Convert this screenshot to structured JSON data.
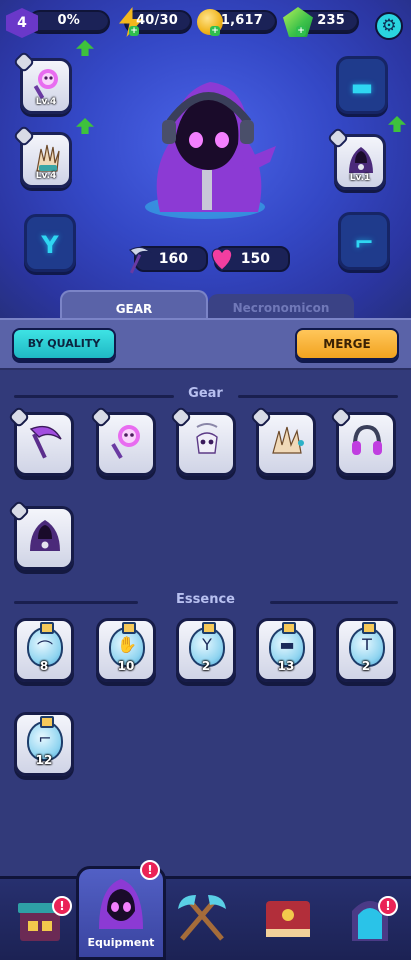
{
  "hud": {
    "level": "4",
    "xp_percent": "0%",
    "energy": "40/30",
    "coins": "1,617",
    "gems": "235",
    "settings_icon": "gear-icon"
  },
  "equipped": {
    "weapon": {
      "level": "Lv.4",
      "icon": "scythe-staff-icon",
      "upgrade_available": true
    },
    "gloves": {
      "level": "Lv.4",
      "icon": "claw-glove-icon",
      "upgrade_available": true
    },
    "necklace": {
      "icon": "necklace-icon",
      "empty": true
    },
    "hat": {
      "icon": "top-hat-icon",
      "empty": true
    },
    "cloak": {
      "level": "Lv.1",
      "icon": "hooded-cloak-icon",
      "upgrade_available": true
    },
    "boots": {
      "icon": "boot-icon",
      "empty": true
    }
  },
  "stats": {
    "attack": "160",
    "health": "150"
  },
  "tabs": {
    "gear": "GEAR",
    "necronomicon": "Necronomicon"
  },
  "toolbar": {
    "sort_label": "BY QUALITY",
    "merge_label": "MERGE"
  },
  "inventory": {
    "gear_heading": "Gear",
    "essence_heading": "Essence",
    "gear_items": [
      {
        "icon": "scythe-icon"
      },
      {
        "icon": "skull-staff-icon"
      },
      {
        "icon": "skull-amulet-icon"
      },
      {
        "icon": "bone-claw-icon"
      },
      {
        "icon": "headphones-icon"
      },
      {
        "icon": "hooded-cloak-icon"
      }
    ],
    "essence_items": [
      {
        "icon": "scythe-essence-icon",
        "count": "8"
      },
      {
        "icon": "glove-essence-icon",
        "count": "10"
      },
      {
        "icon": "necklace-essence-icon",
        "count": "2"
      },
      {
        "icon": "hat-essence-icon",
        "count": "13"
      },
      {
        "icon": "shirt-essence-icon",
        "count": "2"
      },
      {
        "icon": "boot-essence-icon",
        "count": "12"
      }
    ]
  },
  "nav": {
    "shop": {
      "icon": "shop-icon",
      "badge": "!"
    },
    "equipment": {
      "icon": "hooded-hero-icon",
      "label": "Equipment",
      "badge": "!"
    },
    "battle": {
      "icon": "crossed-axes-icon"
    },
    "book": {
      "icon": "spellbook-icon"
    },
    "portal": {
      "icon": "portal-icon",
      "badge": "!"
    }
  }
}
